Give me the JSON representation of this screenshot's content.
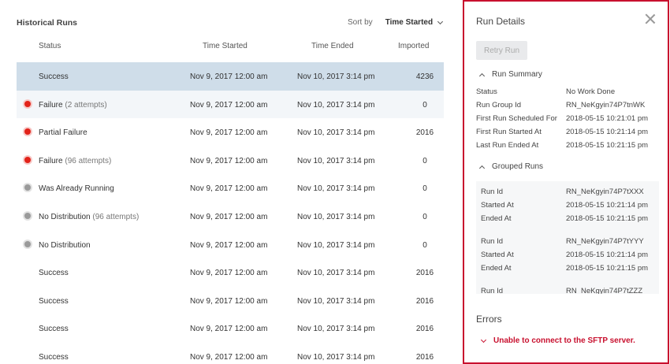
{
  "history": {
    "title": "Historical Runs",
    "sort_label": "Sort by",
    "sort_value": "Time Started",
    "columns": {
      "status": "Status",
      "started": "Time Started",
      "ended": "Time Ended",
      "imported": "Imported"
    },
    "rows": [
      {
        "status": "Success",
        "attempts": "",
        "dot": "none",
        "started": "Nov 9, 2017 12:00 am",
        "ended": "Nov 10, 2017 3:14 pm",
        "imported": "4236",
        "state": "selected"
      },
      {
        "status": "Failure",
        "attempts": "(2 attempts)",
        "dot": "red",
        "started": "Nov 9, 2017 12:00 am",
        "ended": "Nov 10, 2017 3:14 pm",
        "imported": "0",
        "state": "hover"
      },
      {
        "status": "Partial Failure",
        "attempts": "",
        "dot": "red",
        "started": "Nov 9, 2017 12:00 am",
        "ended": "Nov 10, 2017 3:14 pm",
        "imported": "2016",
        "state": ""
      },
      {
        "status": "Failure",
        "attempts": "(96 attempts)",
        "dot": "red",
        "started": "Nov 9, 2017 12:00 am",
        "ended": "Nov 10, 2017 3:14 pm",
        "imported": "0",
        "state": ""
      },
      {
        "status": "Was Already Running",
        "attempts": "",
        "dot": "grey",
        "started": "Nov 9, 2017 12:00 am",
        "ended": "Nov 10, 2017 3:14 pm",
        "imported": "0",
        "state": ""
      },
      {
        "status": "No Distribution",
        "attempts": "(96 attempts)",
        "dot": "grey",
        "started": "Nov 9, 2017 12:00 am",
        "ended": "Nov 10, 2017 3:14 pm",
        "imported": "0",
        "state": ""
      },
      {
        "status": "No Distribution",
        "attempts": "",
        "dot": "grey",
        "started": "Nov 9, 2017 12:00 am",
        "ended": "Nov 10, 2017 3:14 pm",
        "imported": "0",
        "state": ""
      },
      {
        "status": "Success",
        "attempts": "",
        "dot": "none",
        "started": "Nov 9, 2017 12:00 am",
        "ended": "Nov 10, 2017 3:14 pm",
        "imported": "2016",
        "state": ""
      },
      {
        "status": "Success",
        "attempts": "",
        "dot": "none",
        "started": "Nov 9, 2017 12:00 am",
        "ended": "Nov 10, 2017 3:14 pm",
        "imported": "2016",
        "state": ""
      },
      {
        "status": "Success",
        "attempts": "",
        "dot": "none",
        "started": "Nov 9, 2017 12:00 am",
        "ended": "Nov 10, 2017 3:14 pm",
        "imported": "2016",
        "state": ""
      },
      {
        "status": "Success",
        "attempts": "",
        "dot": "none",
        "started": "Nov 9, 2017 12:00 am",
        "ended": "Nov 10, 2017 3:14 pm",
        "imported": "2016",
        "state": ""
      }
    ]
  },
  "details": {
    "title": "Run Details",
    "retry_label": "Retry Run",
    "summary": {
      "heading": "Run Summary",
      "status_label": "Status",
      "status_value": "No Work Done",
      "group_label": "Run Group Id",
      "group_value": "RN_NeKgyin74P7tnWK",
      "scheduled_label": "First Run Scheduled For",
      "scheduled_value": "2018-05-15 10:21:01 pm",
      "first_started_label": "First Run Started At",
      "first_started_value": "2018-05-15 10:21:14 pm",
      "last_ended_label": "Last Run Ended At",
      "last_ended_value": "2018-05-15 10:21:15 pm"
    },
    "grouped": {
      "heading": "Grouped Runs",
      "runs": [
        {
          "id_label": "Run Id",
          "id": "RN_NeKgyin74P7tXXX",
          "started_label": "Started At",
          "started": "2018-05-15 10:21:14 pm",
          "ended_label": "Ended At",
          "ended": "2018-05-15 10:21:15 pm"
        },
        {
          "id_label": "Run Id",
          "id": "RN_NeKgyin74P7tYYY",
          "started_label": "Started At",
          "started": "2018-05-15 10:21:14 pm",
          "ended_label": "Ended At",
          "ended": "2018-05-15 10:21:15 pm"
        },
        {
          "id_label": "Run Id",
          "id": "RN_NeKgyin74P7tZZZ",
          "started_label": "",
          "started": "",
          "ended_label": "",
          "ended": ""
        }
      ]
    },
    "errors": {
      "heading": "Errors",
      "message": "Unable to connect to the SFTP server."
    }
  },
  "colors": {
    "accent": "#c8102e",
    "selected_row": "#cfdde9",
    "failure_dot": "#e2231a",
    "neutral_dot": "#9a9a9a"
  }
}
